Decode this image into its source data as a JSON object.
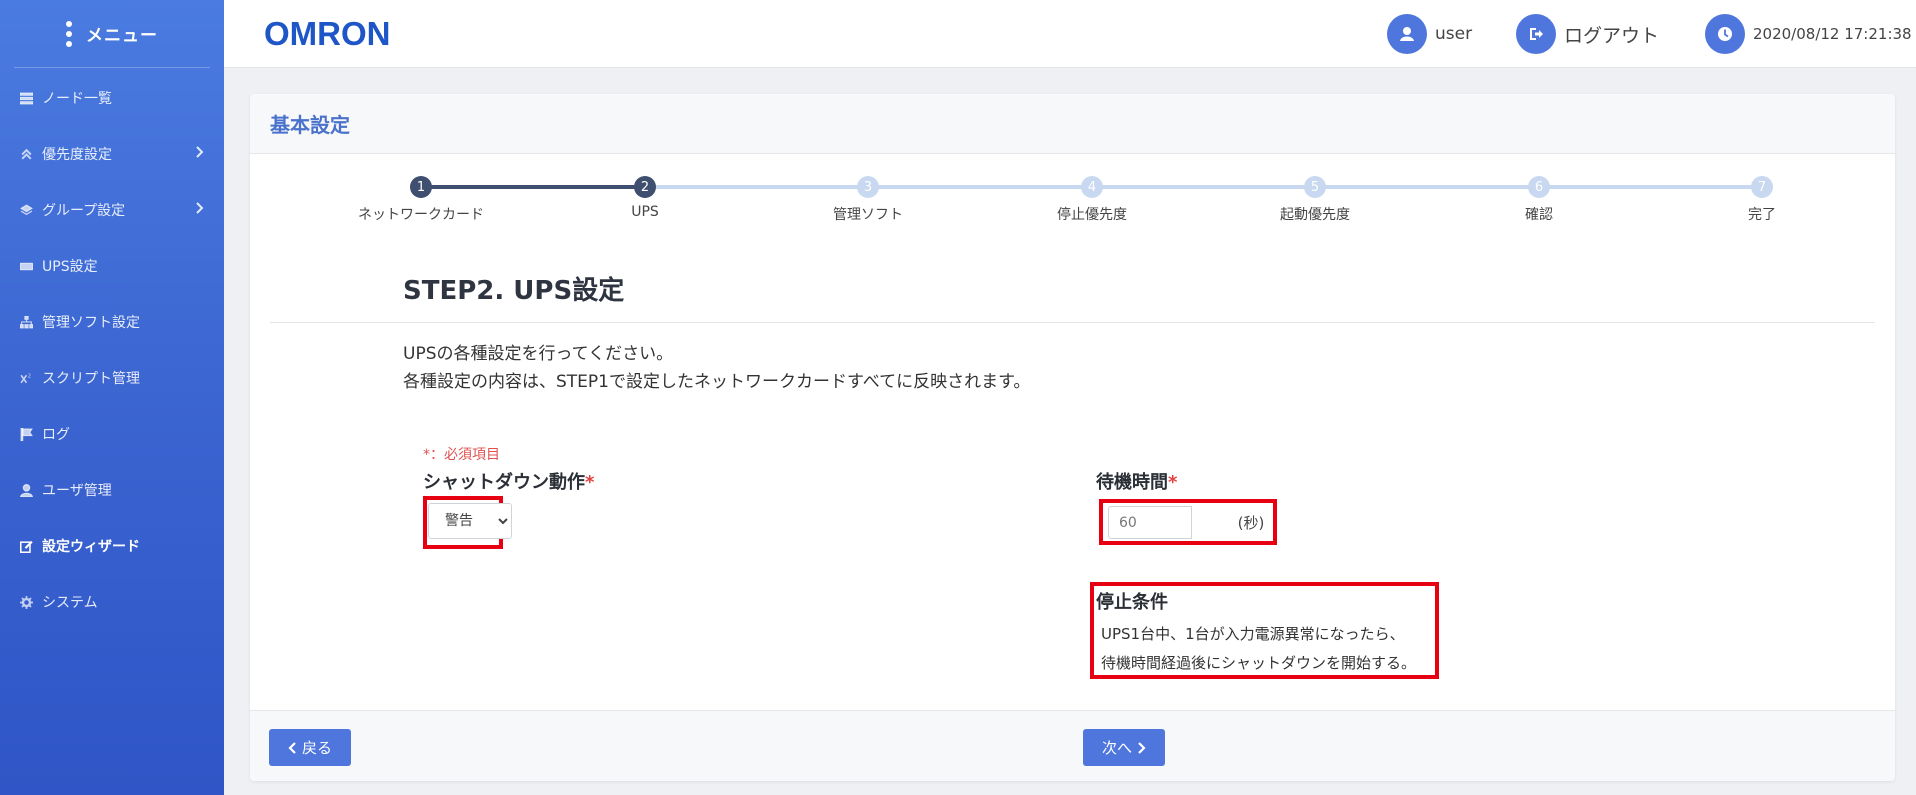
{
  "sidebar": {
    "title": "メニュー",
    "items": [
      {
        "label": "ノード一覧",
        "icon": "list-icon"
      },
      {
        "label": "優先度設定",
        "icon": "priority-icon"
      },
      {
        "label": "グループ設定",
        "icon": "layers-icon"
      },
      {
        "label": "UPS設定",
        "icon": "ups-icon"
      },
      {
        "label": "管理ソフト設定",
        "icon": "sitemap-icon"
      },
      {
        "label": "スクリプト管理",
        "icon": "script-icon"
      },
      {
        "label": "ログ",
        "icon": "flag-icon"
      },
      {
        "label": "ユーザ管理",
        "icon": "user-icon"
      },
      {
        "label": "設定ウィザード",
        "icon": "edit-icon"
      },
      {
        "label": "システム",
        "icon": "gear-icon"
      }
    ]
  },
  "topbar": {
    "logo": "OMRON",
    "user": "user",
    "logout": "ログアウト",
    "datetime": "2020/08/12 17:21:38"
  },
  "card": {
    "title": "基本設定",
    "steps": [
      {
        "num": "1",
        "label": "ネットワークカード"
      },
      {
        "num": "2",
        "label": "UPS"
      },
      {
        "num": "3",
        "label": "管理ソフト"
      },
      {
        "num": "4",
        "label": "停止優先度"
      },
      {
        "num": "5",
        "label": "起動優先度"
      },
      {
        "num": "6",
        "label": "確認"
      },
      {
        "num": "7",
        "label": "完了"
      }
    ],
    "current_step": 2,
    "step_title": "STEP2. UPS設定",
    "desc_line1": "UPSの各種設定を行ってください。",
    "desc_line2": "各種設定の内容は、STEP1で設定したネットワークカードすべてに反映されます。",
    "required_note": "*：必須項目",
    "shutdown_label": "シャットダウン動作",
    "shutdown_value": "警告",
    "wait_label": "待機時間",
    "wait_value": "60",
    "wait_unit": "(秒)",
    "stop_title": "停止条件",
    "stop_line1": "UPS1台中、1台が入力電源異常になったら、",
    "stop_line2": "待機時間経過後にシャットダウンを開始する。",
    "back_label": "戻る",
    "next_label": "次へ"
  },
  "colors": {
    "accent": "#4f76dc",
    "highlight": "#e60012",
    "step_done": "#3f4f70",
    "step_todo": "#c8d8f0"
  }
}
